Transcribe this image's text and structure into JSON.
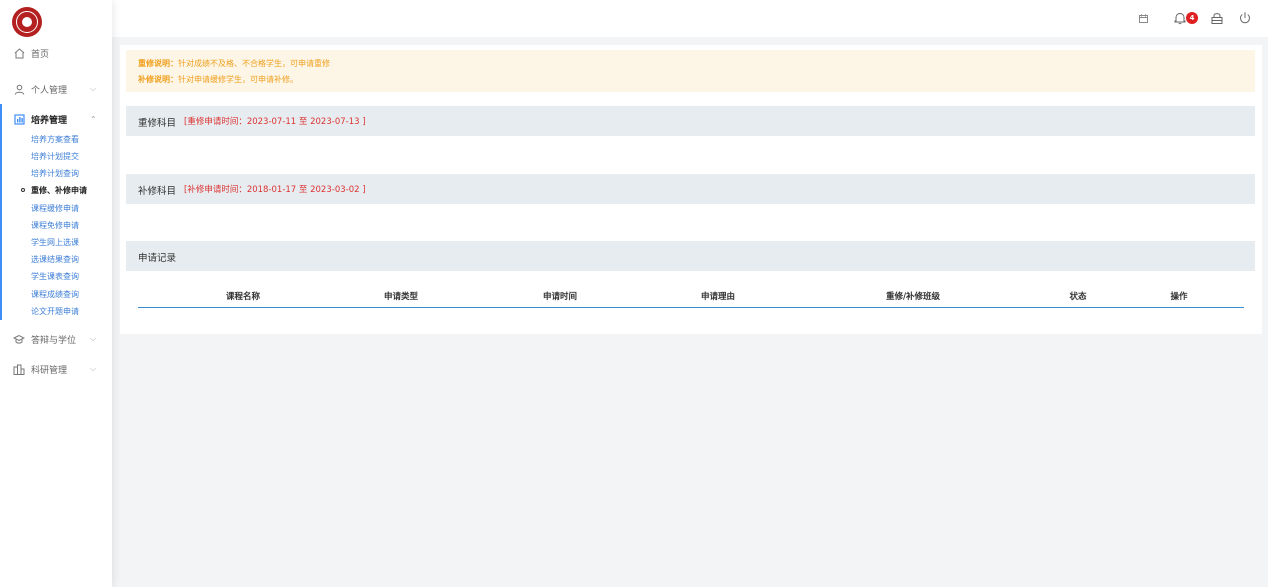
{
  "sidebar": {
    "items": [
      {
        "label": "首页",
        "icon": "home-icon"
      },
      {
        "label": "个人管理",
        "icon": "person-icon"
      },
      {
        "label": "培养管理",
        "icon": "report-icon"
      },
      {
        "label": "答辩与学位",
        "icon": "graduation-cap-icon"
      },
      {
        "label": "科研管理",
        "icon": "buildings-icon"
      }
    ],
    "sub_items": [
      "培养方案查看",
      "培养计划提交",
      "培养计划查询",
      "重修、补修申请",
      "课程缓修申请",
      "课程免修申请",
      "学生网上选课",
      "选课结果查询",
      "学生课表查询",
      "课程成绩查询",
      "论文开题申请"
    ]
  },
  "topbar": {
    "notification_count": "4",
    "icons": [
      "calendar-icon",
      "bell-icon",
      "lock-icon",
      "power-icon"
    ]
  },
  "notice": {
    "line1_label": "重修说明：",
    "line1_text": "针对成绩不及格、不合格学生，可申请重修",
    "line2_label": "补修说明：",
    "line2_text": "针对申请缓修学生，可申请补修。"
  },
  "retake": {
    "title": "重修科目",
    "time": "[重修申请时间：2023-07-11   至 2023-07-13  ]"
  },
  "makeup": {
    "title": "补修科目",
    "time": "[补修申请时间：2018-01-17   至 2023-03-02  ]"
  },
  "records": {
    "title": "申请记录",
    "columns": [
      "课程名称",
      "申请类型",
      "申请时间",
      "申请理由",
      "重修/补修班级",
      "状态",
      "操作"
    ]
  },
  "colors": {
    "accent": "#3e8ef7",
    "notice_text": "#f0a020",
    "time_text": "#dd3333",
    "badge": "#e02020"
  }
}
